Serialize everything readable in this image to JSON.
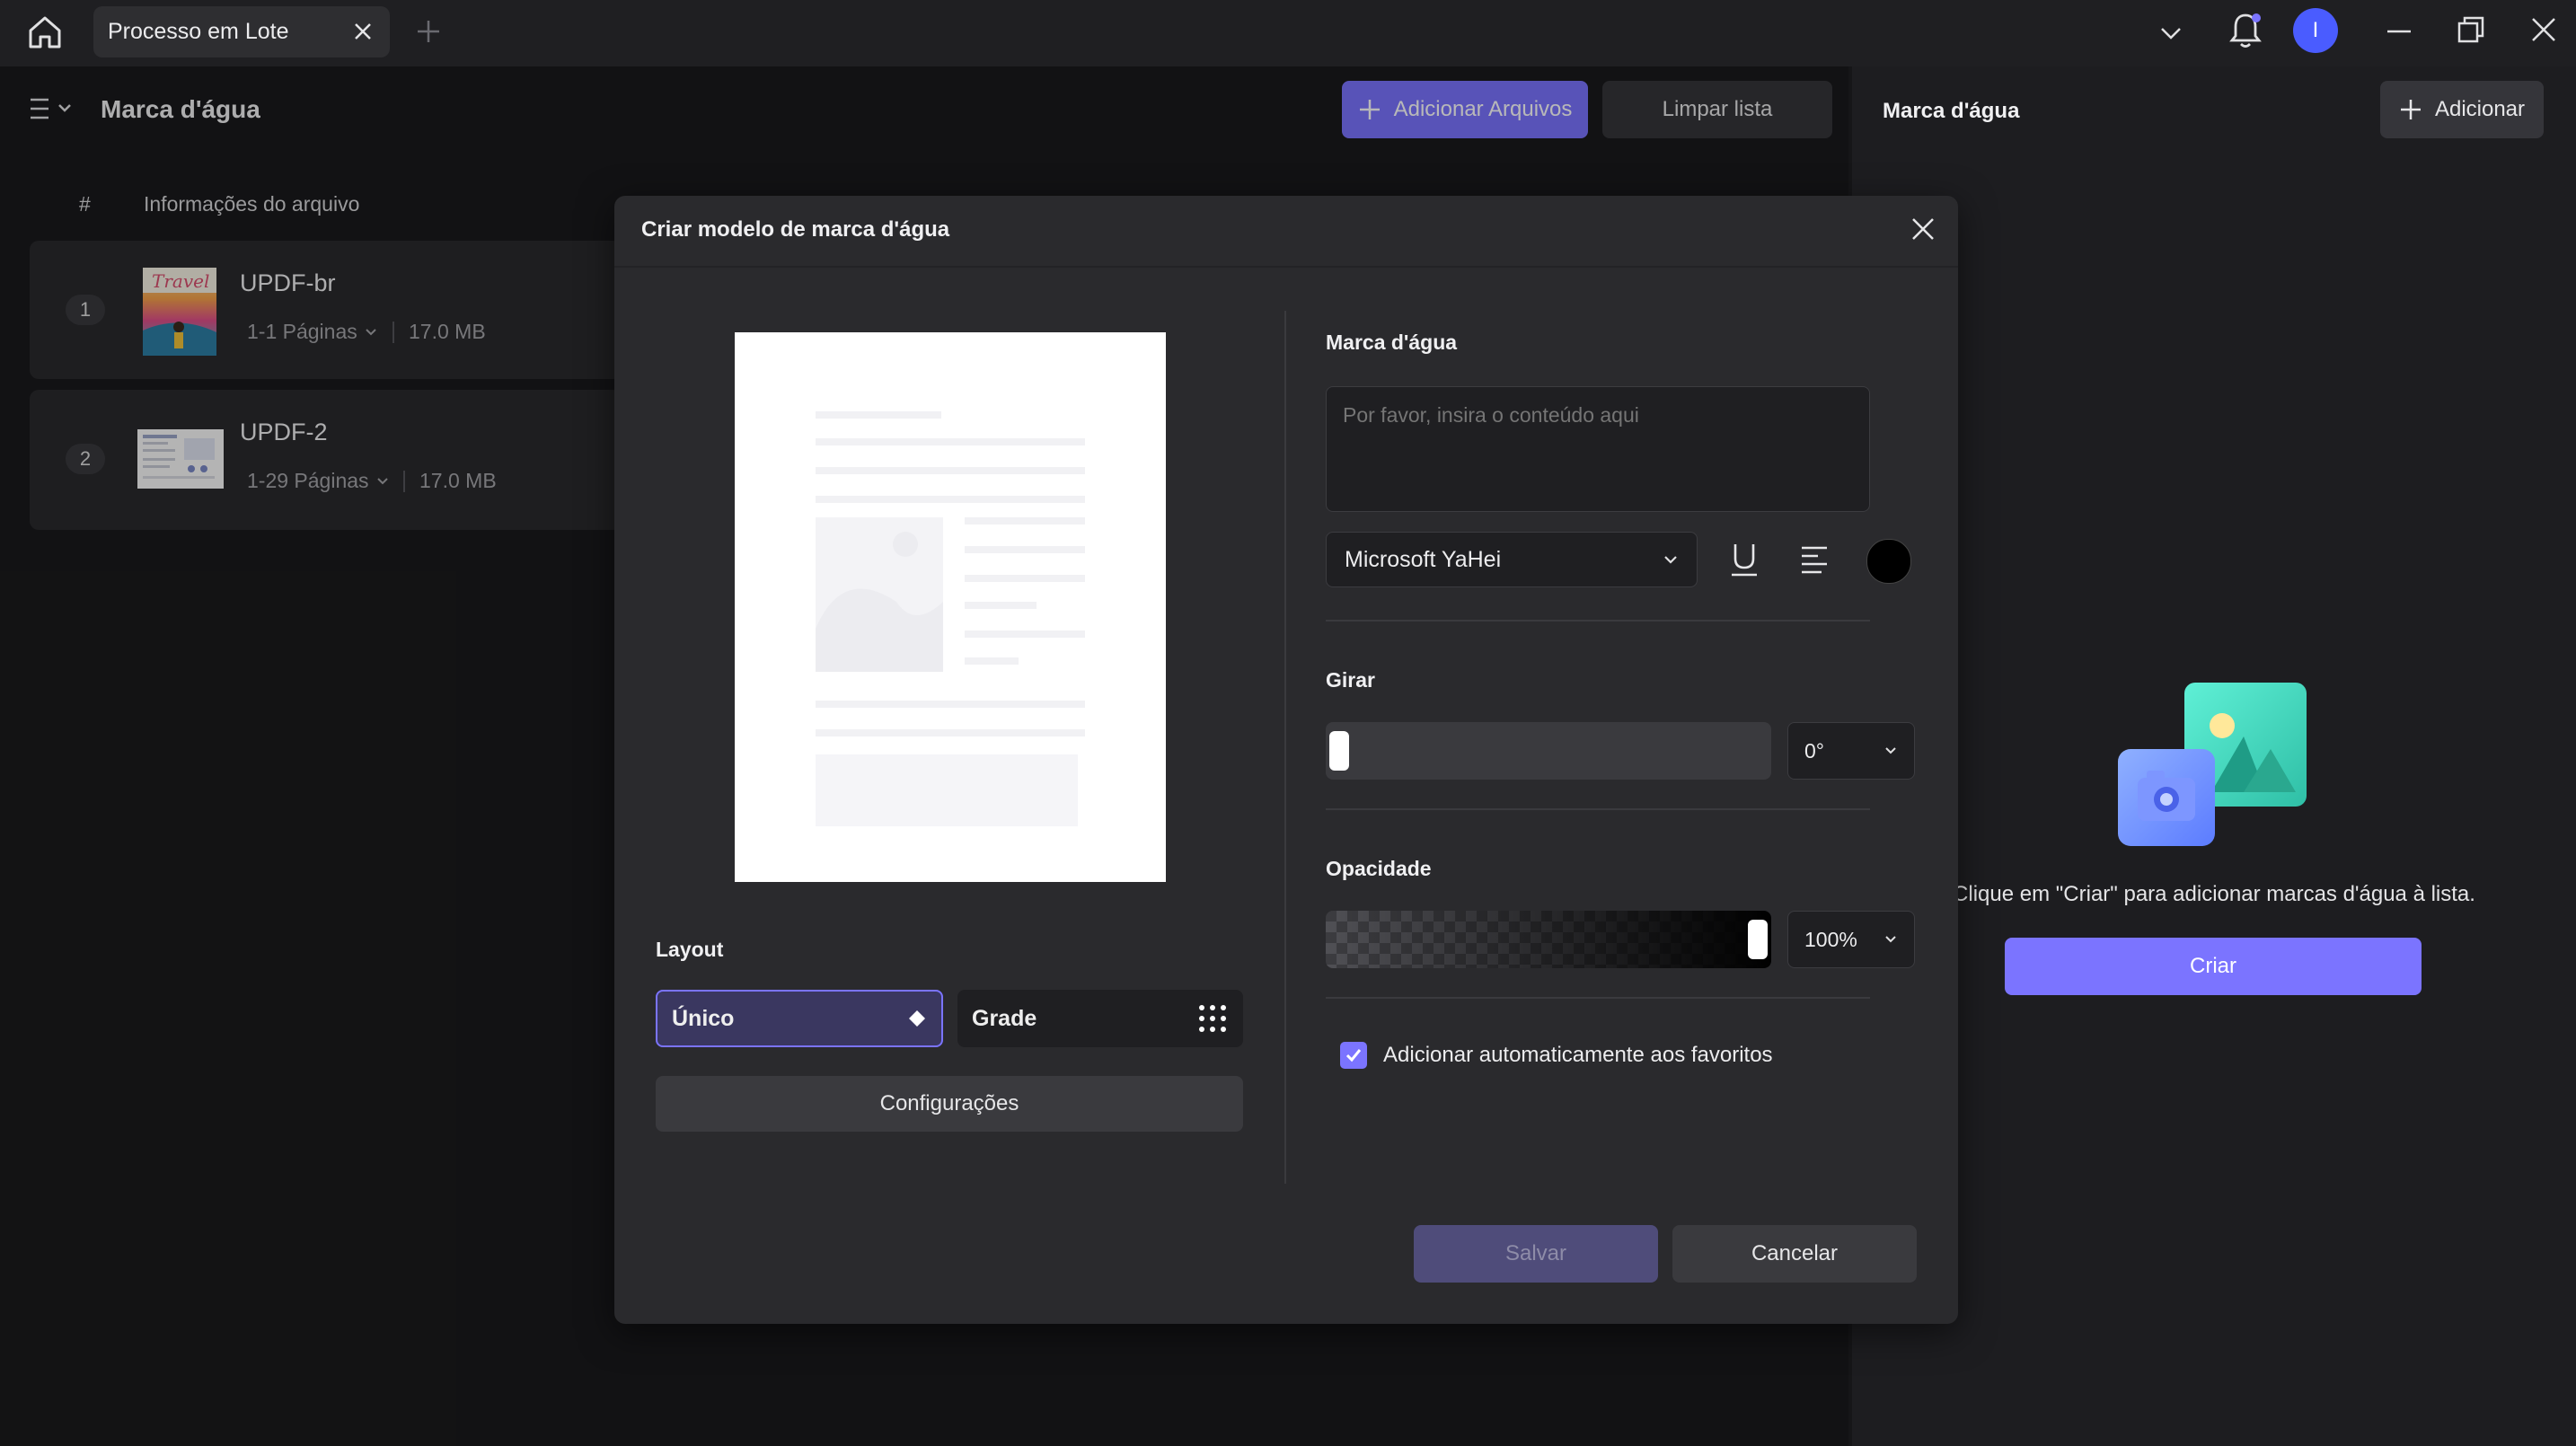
{
  "titlebar": {
    "tab_label": "Processo em Lote",
    "avatar_initial": "I",
    "avatar_color": "#4a5cff"
  },
  "left": {
    "title": "Marca d'água",
    "add_files": "Adicionar Arquivos",
    "clear_list": "Limpar lista",
    "col_index": "#",
    "col_info": "Informações do arquivo",
    "files": [
      {
        "index": "1",
        "name": "UPDF-br",
        "pages": "1-1 Páginas",
        "size": "17.0 MB"
      },
      {
        "index": "2",
        "name": "UPDF-2",
        "pages": "1-29 Páginas",
        "size": "17.0 MB"
      }
    ]
  },
  "right": {
    "title": "Marca d'água",
    "add": "Adicionar",
    "hint": "Clique em \"Criar\" para adicionar marcas d'água à lista.",
    "create": "Criar"
  },
  "dialog": {
    "title": "Criar modelo de marca d'água",
    "layout_label": "Layout",
    "layout_single": "Único",
    "layout_grid": "Grade",
    "settings": "Configurações",
    "watermark_label": "Marca d'água",
    "watermark_placeholder": "Por favor, insira o conteúdo aqui",
    "font": "Microsoft YaHei",
    "text_color": "#000000",
    "rotate_label": "Girar",
    "rotate_value": "0°",
    "rotate_fraction": 0,
    "opacity_label": "Opacidade",
    "opacity_value": "100%",
    "opacity_fraction": 1,
    "auto_fav": "Adicionar automaticamente aos favoritos",
    "auto_fav_checked": true,
    "save": "Salvar",
    "cancel": "Cancelar"
  },
  "colors": {
    "accent": "#7b74ff"
  }
}
